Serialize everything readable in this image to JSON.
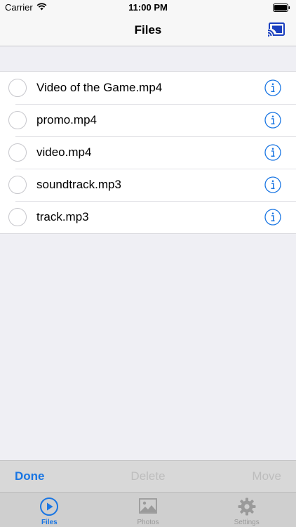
{
  "status_bar": {
    "carrier": "Carrier",
    "time": "11:00 PM",
    "icons": [
      "wifi-icon",
      "battery-icon"
    ]
  },
  "nav": {
    "title": "Files",
    "right_icon": "cast-icon"
  },
  "files": [
    {
      "name": "Video of the Game.mp4"
    },
    {
      "name": "promo.mp4"
    },
    {
      "name": "video.mp4"
    },
    {
      "name": "soundtrack.mp3"
    },
    {
      "name": "track.mp3"
    }
  ],
  "toolbar": {
    "done_label": "Done",
    "delete_label": "Delete",
    "move_label": "Move"
  },
  "tabs": [
    {
      "label": "Files",
      "icon": "play-circle-icon",
      "active": true
    },
    {
      "label": "Photos",
      "icon": "photo-icon",
      "active": false
    },
    {
      "label": "Settings",
      "icon": "gear-icon",
      "active": false
    }
  ],
  "colors": {
    "accent": "#1a76e3",
    "disabled": "#bdbdbd",
    "background": "#efeff4"
  }
}
